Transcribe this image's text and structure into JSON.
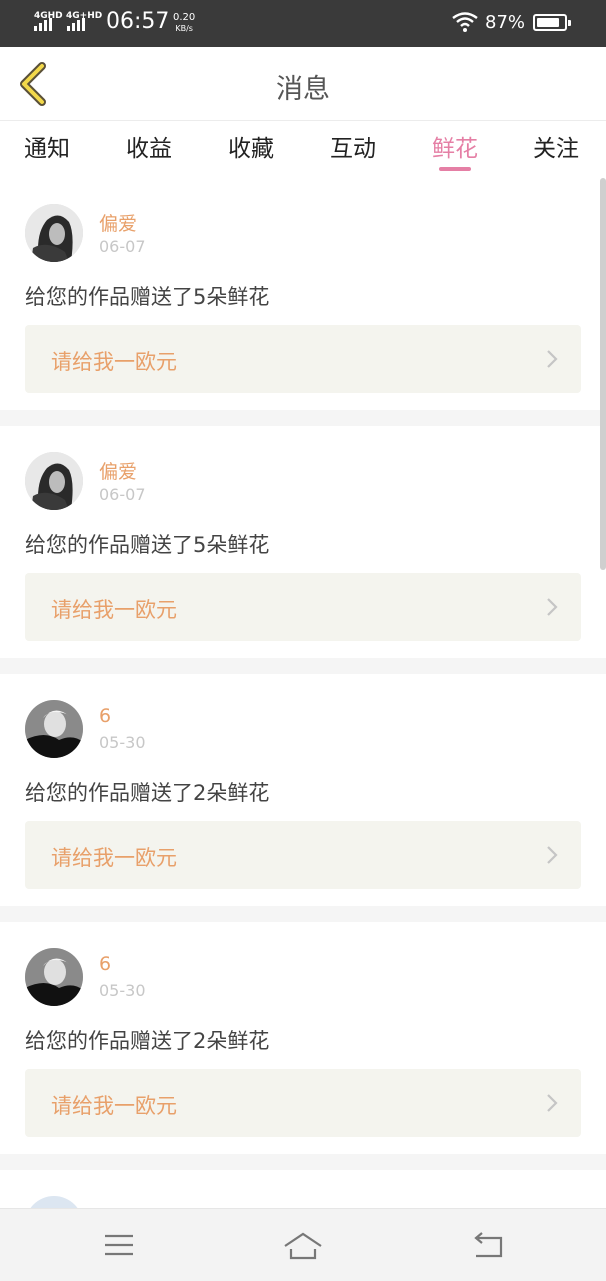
{
  "status_bar": {
    "network_1": "4GHD",
    "network_2": "4G+HD",
    "time": "06:57",
    "speed_value": "0.20",
    "speed_unit": "KB/s",
    "battery_text": "87%",
    "battery_level": 0.87
  },
  "header": {
    "title": "消息",
    "back_icon": "chevron-left-icon"
  },
  "tabs": [
    {
      "label": "通知",
      "active": false
    },
    {
      "label": "收益",
      "active": false
    },
    {
      "label": "收藏",
      "active": false
    },
    {
      "label": "互动",
      "active": false
    },
    {
      "label": "鲜花",
      "active": true
    },
    {
      "label": "关注",
      "active": false
    }
  ],
  "accent_color": "#e57fa5",
  "name_color": "#e8a06a",
  "messages": [
    {
      "name": "偏爱",
      "date": "06-07",
      "text": "给您的作品赠送了5朵鲜花",
      "reply": "请给我一欧元"
    },
    {
      "name": "偏爱",
      "date": "06-07",
      "text": "给您的作品赠送了5朵鲜花",
      "reply": "请给我一欧元"
    },
    {
      "name": "6",
      "date": "05-30",
      "text": "给您的作品赠送了2朵鲜花",
      "reply": "请给我一欧元"
    },
    {
      "name": "6",
      "date": "05-30",
      "text": "给您的作品赠送了2朵鲜花",
      "reply": "请给我一欧元"
    }
  ],
  "nav_bar": {
    "menu_icon": "menu-icon",
    "home_icon": "home-icon",
    "back_icon": "back-icon"
  }
}
